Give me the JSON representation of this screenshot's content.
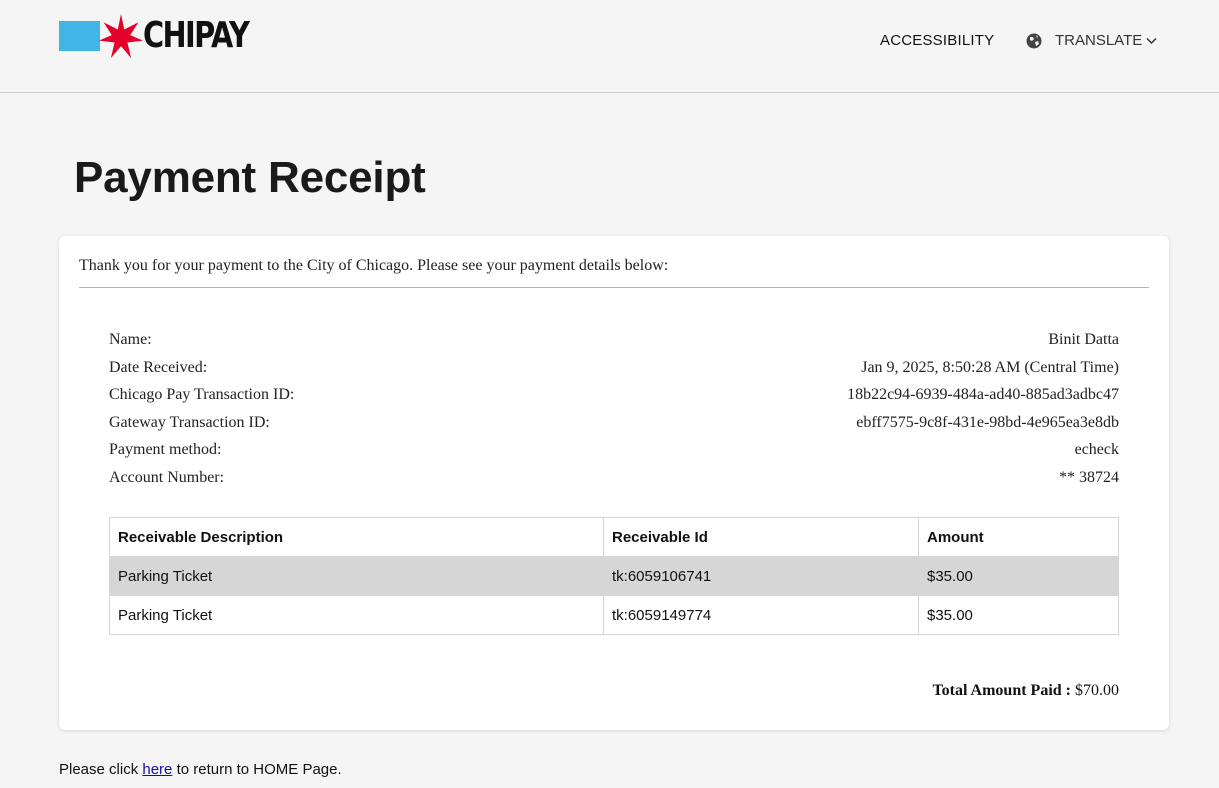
{
  "header": {
    "logo_text": "CHIPAY",
    "accessibility_label": "ACCESSIBILITY",
    "translate_label": "TRANSLATE",
    "colors": {
      "flag_blue": "#41b6e6",
      "star_red": "#e4002b"
    }
  },
  "page": {
    "title": "Payment Receipt"
  },
  "receipt": {
    "intro": "Thank you for your payment to the City of Chicago. Please see your payment details below:",
    "details": [
      {
        "label": "Name:",
        "value": "Binit Datta"
      },
      {
        "label": "Date Received:",
        "value": "Jan 9, 2025, 8:50:28 AM (Central Time)"
      },
      {
        "label": "Chicago Pay Transaction ID:",
        "value": "18b22c94-6939-484a-ad40-885ad3adbc47"
      },
      {
        "label": "Gateway Transaction ID:",
        "value": "ebff7575-9c8f-431e-98bd-4e965ea3e8db"
      },
      {
        "label": "Payment method:",
        "value": "echeck"
      },
      {
        "label": "Account Number:",
        "value": "** 38724"
      }
    ],
    "table": {
      "headers": [
        "Receivable Description",
        "Receivable Id",
        "Amount"
      ],
      "rows": [
        [
          "Parking Ticket",
          "tk:6059106741",
          "$35.00"
        ],
        [
          "Parking Ticket",
          "tk:6059149774",
          "$35.00"
        ]
      ]
    },
    "total_label": "Total Amount Paid :",
    "total_value": "$70.00"
  },
  "footer": {
    "before_link": "Please click ",
    "link_text": "here",
    "after_link": " to return to HOME Page."
  }
}
